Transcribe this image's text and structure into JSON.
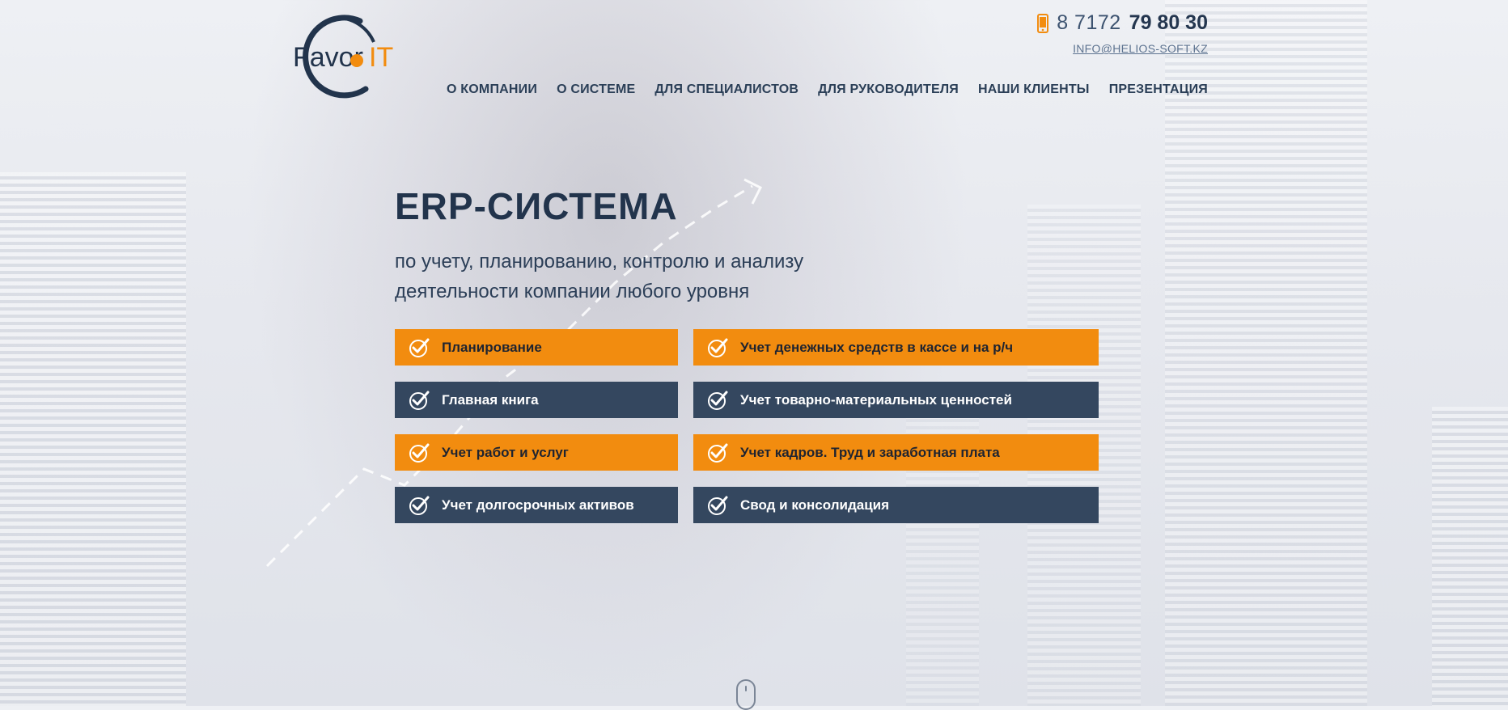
{
  "logo": {
    "text_part1": "Favor",
    "text_part2": "IT"
  },
  "contact": {
    "phone_prefix": "8 7172",
    "phone_main": "79 80 30",
    "email": "INFO@HELIOS-SOFT.KZ"
  },
  "nav": [
    {
      "label": "О КОМПАНИИ"
    },
    {
      "label": "О СИСТЕМЕ"
    },
    {
      "label": "ДЛЯ СПЕЦИАЛИСТОВ"
    },
    {
      "label": "ДЛЯ РУКОВОДИТЕЛЯ"
    },
    {
      "label": "НАШИ КЛИЕНТЫ"
    },
    {
      "label": "ПРЕЗЕНТАЦИЯ"
    }
  ],
  "hero": {
    "title": "ERP-СИСТЕМА",
    "subtitle_line1": "по учету, планированию, контролю и анализу",
    "subtitle_line2": "деятельности компании любого уровня"
  },
  "features": [
    {
      "label": "Планирование",
      "style": "orange"
    },
    {
      "label": "Учет денежных средств в кассе и на р/ч",
      "style": "orange"
    },
    {
      "label": "Главная книга",
      "style": "navy"
    },
    {
      "label": "Учет товарно-материальных ценностей",
      "style": "navy"
    },
    {
      "label": "Учет работ и услуг",
      "style": "orange"
    },
    {
      "label": "Учет кадров. Труд и заработная плата",
      "style": "orange"
    },
    {
      "label": "Учет долгосрочных активов",
      "style": "navy"
    },
    {
      "label": "Свод и консолидация",
      "style": "navy"
    }
  ],
  "colors": {
    "accent_orange": "#f28c0f",
    "navy": "#34475f",
    "heading": "#22344c"
  },
  "icons": {
    "phone": "mobile-phone-icon",
    "feature": "check-badge-icon",
    "scroll": "mouse-scroll-icon"
  }
}
